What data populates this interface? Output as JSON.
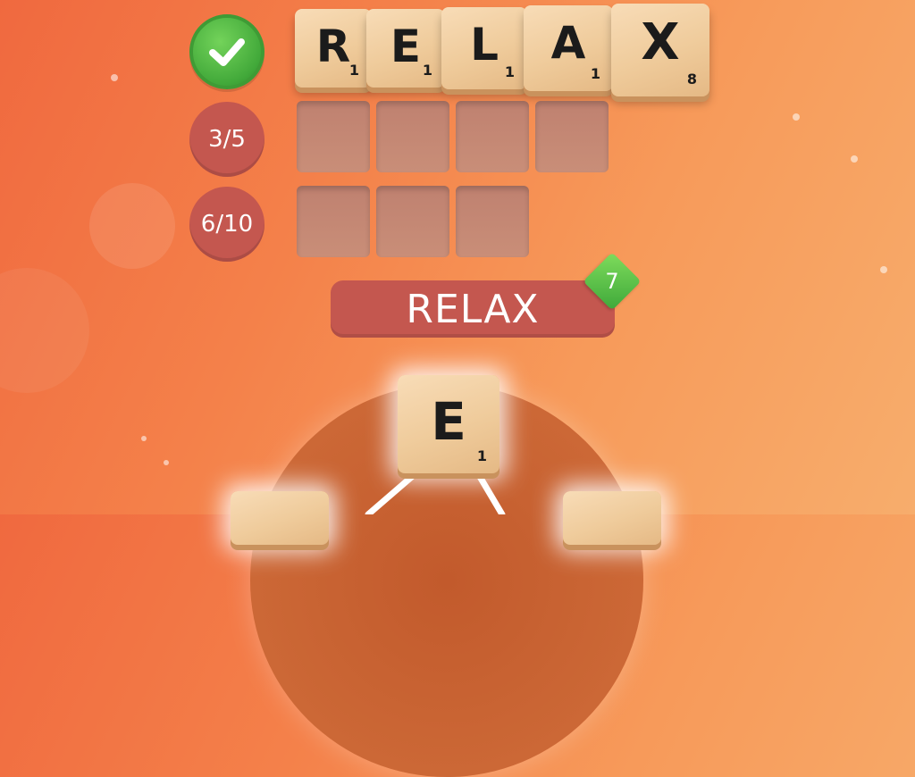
{
  "found_word": {
    "tiles": [
      {
        "letter": "R",
        "points": "1"
      },
      {
        "letter": "E",
        "points": "1"
      },
      {
        "letter": "L",
        "points": "1"
      },
      {
        "letter": "A",
        "points": "1"
      },
      {
        "letter": "X",
        "points": "8"
      }
    ]
  },
  "rows": [
    {
      "status": "done",
      "status_icon": "checkmark-icon"
    },
    {
      "status": "3/5",
      "slots": 4
    },
    {
      "status": "6/10",
      "slots": 3
    }
  ],
  "current_word": "RELAX",
  "bonus_gem": "7",
  "wheel": {
    "tiles": [
      {
        "letter": "E",
        "points": "1"
      }
    ]
  },
  "colors": {
    "background_start": "#f0693f",
    "background_end": "#f7ad6c",
    "status_red": "#c4574f",
    "success_green": "#42a93a",
    "tile_wood": "#efcb9b"
  }
}
